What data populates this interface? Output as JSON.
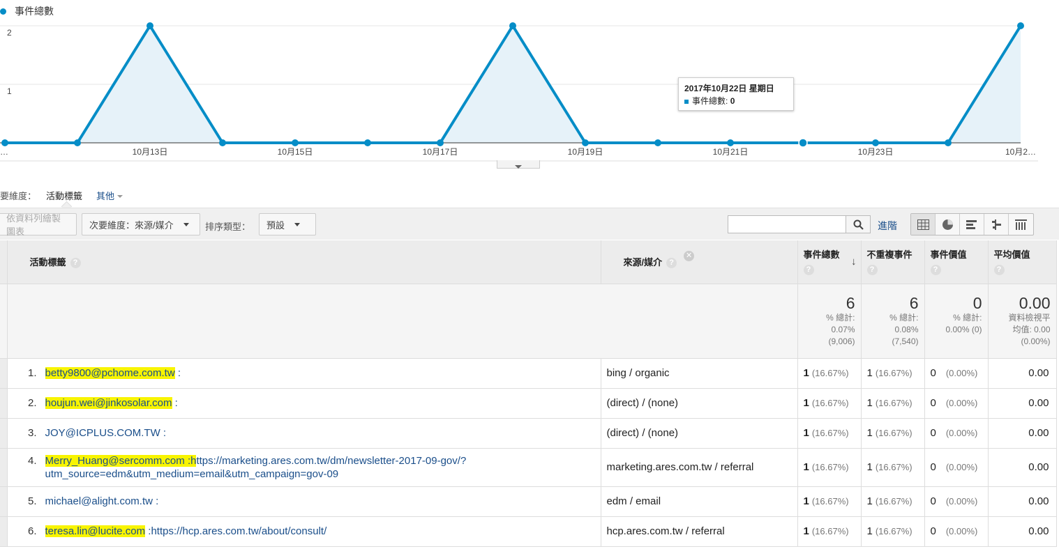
{
  "chart": {
    "legend_label": "事件總數",
    "series_color": "#058dc7",
    "y_ticks": [
      "2",
      "1"
    ],
    "x_ticks": [
      "…",
      "10月13日",
      "10月15日",
      "10月17日",
      "10月19日",
      "10月21日",
      "10月23日",
      "10月2…"
    ],
    "tooltip_date": "2017年10月22日 星期日",
    "tooltip_metric": "事件總數:",
    "tooltip_value": "0"
  },
  "chart_data": {
    "type": "area",
    "title": "",
    "series": [
      {
        "name": "事件總數",
        "values": [
          0,
          0,
          2,
          0,
          0,
          0,
          0,
          2,
          0,
          0,
          0,
          0,
          0,
          0,
          2
        ]
      }
    ],
    "ylim": [
      0,
      2
    ],
    "grid": true,
    "legend": "top-left"
  },
  "dimension": {
    "label": "要維度：",
    "active": "活動標籤",
    "other": "其他"
  },
  "toolbar": {
    "plot_rows": "依資料列繪製圖表",
    "secondary_dim": "次要維度：來源/媒介",
    "sort_label": "排序類型：",
    "sort_value": "預設",
    "search_placeholder": "",
    "advanced": "進階"
  },
  "table": {
    "headers": {
      "label": "活動標籤",
      "source": "來源/媒介",
      "total_events": "事件總數",
      "unique_events": "不重複事件",
      "event_value": "事件價值",
      "avg_value": "平均價值"
    },
    "totals": {
      "total_events": {
        "value": "6",
        "l1": "% 總計:",
        "l2": "0.07%",
        "l3": "(9,006)"
      },
      "unique_events": {
        "value": "6",
        "l1": "% 總計:",
        "l2": "0.08%",
        "l3": "(7,540)"
      },
      "event_value": {
        "value": "0",
        "l1": "% 總計:",
        "l2": "0.00% (0)",
        "l3": ""
      },
      "avg_value": {
        "value": "0.00",
        "l1": "資料檢視平",
        "l2": "均值: 0.00",
        "l3": "(0.00%)"
      }
    },
    "rows": [
      {
        "idx": "1.",
        "hl": "betty9800@pchome.com.tw",
        "rest": " :",
        "rest2": "",
        "source": "bing / organic",
        "te": "1",
        "te_pct": "(16.67%)",
        "ue": "1",
        "ue_pct": "(16.67%)",
        "ev": "0",
        "ev_pct": "(0.00%)",
        "av": "0.00"
      },
      {
        "idx": "2.",
        "hl": "houjun.wei@jinkosolar.com",
        "rest": " :",
        "rest2": "",
        "source": "(direct) / (none)",
        "te": "1",
        "te_pct": "(16.67%)",
        "ue": "1",
        "ue_pct": "(16.67%)",
        "ev": "0",
        "ev_pct": "(0.00%)",
        "av": "0.00"
      },
      {
        "idx": "3.",
        "hl": "",
        "rest": "JOY@ICPLUS.COM.TW :",
        "rest2": "",
        "source": "(direct) / (none)",
        "te": "1",
        "te_pct": "(16.67%)",
        "ue": "1",
        "ue_pct": "(16.67%)",
        "ev": "0",
        "ev_pct": "(0.00%)",
        "av": "0.00"
      },
      {
        "idx": "4.",
        "hl": "Merry_Huang@sercomm.com :h",
        "rest": "ttps://marketing.ares.com.tw/dm/newsletter-2017-09-gov/?",
        "rest2": "utm_source=edm&utm_medium=email&utm_campaign=gov-09",
        "source": "marketing.ares.com.tw / referral",
        "te": "1",
        "te_pct": "(16.67%)",
        "ue": "1",
        "ue_pct": "(16.67%)",
        "ev": "0",
        "ev_pct": "(0.00%)",
        "av": "0.00"
      },
      {
        "idx": "5.",
        "hl": "",
        "rest": "michael@alight.com.tw :",
        "rest2": "",
        "source": "edm / email",
        "te": "1",
        "te_pct": "(16.67%)",
        "ue": "1",
        "ue_pct": "(16.67%)",
        "ev": "0",
        "ev_pct": "(0.00%)",
        "av": "0.00"
      },
      {
        "idx": "6.",
        "hl": "teresa.lin@lucite.com",
        "rest": " :https://hcp.ares.com.tw/about/consult/",
        "rest2": "",
        "source": "hcp.ares.com.tw / referral",
        "te": "1",
        "te_pct": "(16.67%)",
        "ue": "1",
        "ue_pct": "(16.67%)",
        "ev": "0",
        "ev_pct": "(0.00%)",
        "av": "0.00"
      }
    ]
  }
}
